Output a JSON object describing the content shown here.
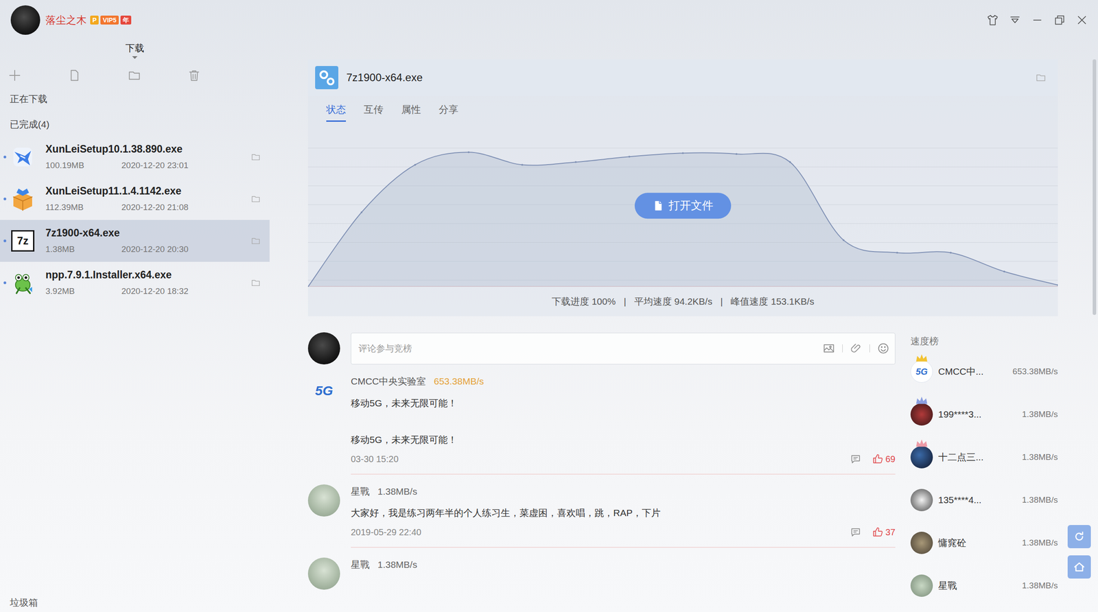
{
  "user": {
    "name": "落尘之木",
    "badges": [
      {
        "text": "P",
        "color": "#f3a81e"
      },
      {
        "text": "VIP5",
        "color": "#f2762e"
      },
      {
        "text": "年",
        "color": "#e5483c"
      }
    ]
  },
  "sidebar": {
    "tab": "下载",
    "sections": [
      "正在下载",
      "已完成(4)"
    ],
    "items": [
      {
        "kind": "xunlei",
        "icon_text": "",
        "name": "XunLeiSetup10.1.38.890.exe",
        "size": "100.19MB",
        "date": "2020-12-20 23:01",
        "selected": false
      },
      {
        "kind": "box",
        "icon_text": "",
        "name": "XunLeiSetup11.1.4.1142.exe",
        "size": "112.39MB",
        "date": "2020-12-20 21:08",
        "selected": false
      },
      {
        "kind": "sevenzip",
        "icon_text": "7z",
        "name": "7z1900-x64.exe",
        "size": "1.38MB",
        "date": "2020-12-20 20:30",
        "selected": true
      },
      {
        "kind": "npp",
        "icon_text": "",
        "name": "npp.7.9.1.Installer.x64.exe",
        "size": "3.92MB",
        "date": "2020-12-20 18:32",
        "selected": false
      }
    ],
    "trash": "垃圾箱"
  },
  "detail": {
    "title": "7z1900-x64.exe",
    "tabs": [
      {
        "label": "状态",
        "selected": true
      },
      {
        "label": "互传",
        "selected": false
      },
      {
        "label": "属性",
        "selected": false
      },
      {
        "label": "分享",
        "selected": false
      }
    ],
    "chart": {
      "max": 170,
      "series": [
        {
          "name": "speed",
          "values": [
            0,
            83,
            136,
            150,
            136,
            139,
            145,
            149,
            148,
            139,
            52,
            38,
            38,
            17,
            2
          ]
        }
      ]
    },
    "open_button": "打开文件",
    "stats": [
      "下载进度 100%",
      "平均速度 94.2KB/s",
      "峰值速度 153.1KB/s"
    ],
    "separator": "|"
  },
  "comment_box": {
    "placeholder": "评论参与竞榜"
  },
  "comments": [
    {
      "kind": "logo",
      "avatar_text": "5G",
      "user": "CMCC中央实验室",
      "speed": "653.38MB/s",
      "highlight": true,
      "lines": [
        "移动5G，未来无限可能！",
        "",
        "移动5G，未来无限可能！"
      ],
      "time": "03-30 15:20",
      "likes": "69"
    },
    {
      "kind": "photo",
      "avatar_text": "",
      "user": "星戰",
      "speed": "1.38MB/s",
      "highlight": false,
      "lines": [
        "大家好，我是练习两年半的个人练习生，菜虚困，喜欢唱，跳，RAP，下片"
      ],
      "time": "2019-05-29 22:40",
      "likes": "37"
    },
    {
      "kind": "photo",
      "avatar_text": "",
      "user": "星戰",
      "speed": "1.38MB/s",
      "highlight": false,
      "lines": []
    }
  ],
  "ranking": {
    "title": "速度榜",
    "items": [
      {
        "kind": "logo",
        "avatar_text": "5G",
        "name": "CMCC中...",
        "speed": "653.38MB/s",
        "crown": true,
        "color": "#f2c230"
      },
      {
        "kind": "photo",
        "avatar_text": "",
        "name": "199****3...",
        "speed": "1.38MB/s",
        "crown": true,
        "color": "#8c9fe0"
      },
      {
        "kind": "photo",
        "avatar_text": "",
        "name": "十二点三...",
        "speed": "1.38MB/s",
        "crown": true,
        "color": "#ec9aa6"
      },
      {
        "kind": "photo",
        "avatar_text": "",
        "name": "135****4...",
        "speed": "1.38MB/s",
        "crown": false
      },
      {
        "kind": "photo",
        "avatar_text": "",
        "name": "慵窕砼",
        "speed": "1.38MB/s",
        "crown": false
      },
      {
        "kind": "photo",
        "avatar_text": "",
        "name": "星戰",
        "speed": "1.38MB/s",
        "crown": false
      }
    ]
  }
}
